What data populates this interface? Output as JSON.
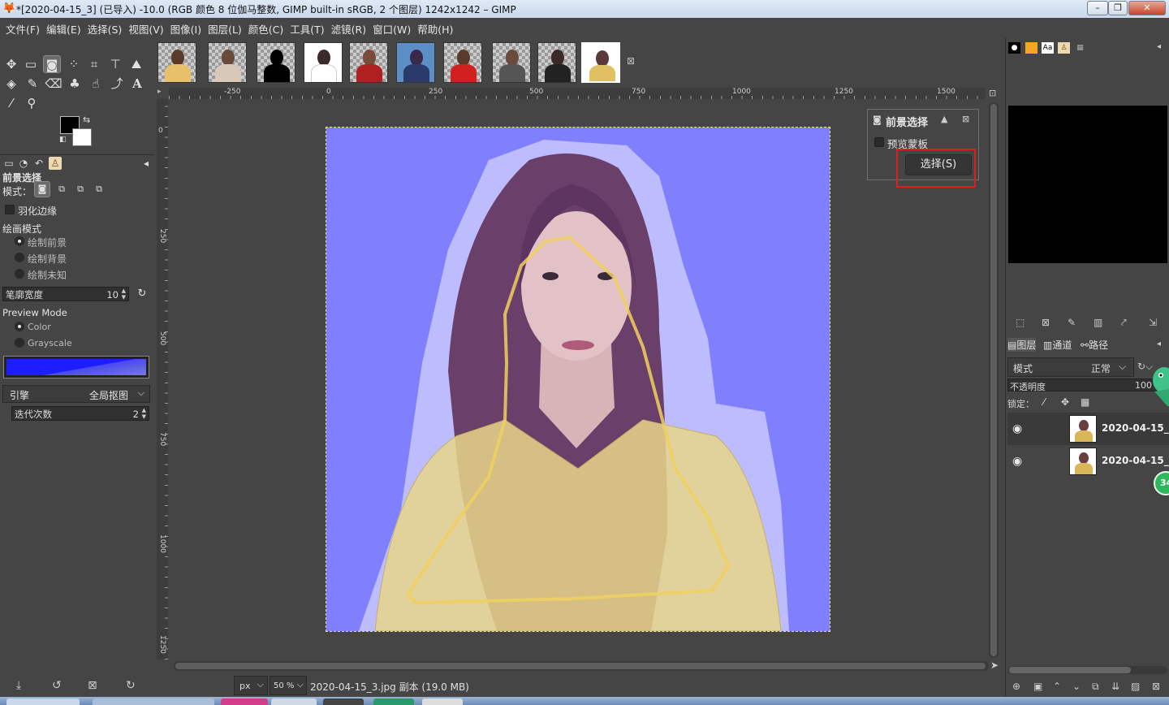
{
  "window": {
    "title": "*[2020-04-15_3] (已导入) -10.0 (RGB 颜色 8 位伽马整数, GIMP built-in sRGB, 2 个图层) 1242x1242 – GIMP",
    "minimize": "–",
    "maximize": "❐",
    "close": "✕"
  },
  "menu": [
    "文件(F)",
    "编辑(E)",
    "选择(S)",
    "视图(V)",
    "图像(I)",
    "图层(L)",
    "颜色(C)",
    "工具(T)",
    "滤镜(R)",
    "窗口(W)",
    "帮助(H)"
  ],
  "tool_options": {
    "title": "前景选择",
    "mode_label": "模式：",
    "feather_label": "羽化边缘",
    "draw_mode_label": "绘画模式",
    "draw_options": [
      "绘制前景",
      "绘制背景",
      "绘制未知"
    ],
    "stroke_width_label": "笔廓宽度",
    "stroke_width_value": "10",
    "preview_mode_label": "Preview Mode",
    "preview_options": [
      "Color",
      "Grayscale"
    ],
    "engine_label": "引擎",
    "engine_value": "全局抠图",
    "iterations_label": "迭代次数",
    "iterations_value": "2",
    "colors": {
      "foreground": "#000000",
      "background": "#ffffff",
      "mask": "#1d1dff"
    }
  },
  "rulers": {
    "h_ticks": [
      "-250",
      "0",
      "250",
      "500",
      "750",
      "1000",
      "1250",
      "1500"
    ],
    "v_ticks": [
      "0",
      "250",
      "500",
      "750",
      "1000",
      "1250"
    ]
  },
  "fg_dialog": {
    "title": "前景选择",
    "preview_mask_label": "预览蒙板",
    "select_button": "选择(S)"
  },
  "status": {
    "unit": "px",
    "zoom": "50 %",
    "text": "2020-04-15_3.jpg 副本 (19.0 MB)"
  },
  "layers_panel": {
    "tabs": [
      "图层",
      "通道",
      "路径"
    ],
    "mode_label": "模式",
    "mode_value": "正常",
    "opacity_label": "不透明度",
    "opacity_value": "100",
    "lock_label": "锁定：",
    "layers": [
      {
        "name": "2020-04-15_3"
      },
      {
        "name": "2020-04-15_3"
      }
    ]
  },
  "badge": "34"
}
